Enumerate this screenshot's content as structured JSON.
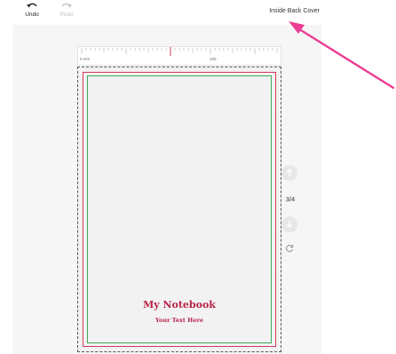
{
  "toolbar": {
    "undo_label": "Undo",
    "redo_label": "Redo",
    "view_title": "Inside Back Cover"
  },
  "ruler": {
    "start_label": "0 mm",
    "mid_label": "100"
  },
  "page": {
    "title": "My Notebook",
    "subtitle": "Your Text Here"
  },
  "page_nav": {
    "indicator": "3/4"
  },
  "colors": {
    "bleed_line": "#d33a5a",
    "safe_line": "#3daa5a",
    "text_accent": "#b9244a",
    "annotation_arrow": "#ee3d94"
  },
  "icons": {
    "undo": "undo-icon",
    "redo": "redo-icon",
    "page_up": "arrow-up-icon",
    "page_down": "arrow-down-icon",
    "refresh": "refresh-icon"
  }
}
